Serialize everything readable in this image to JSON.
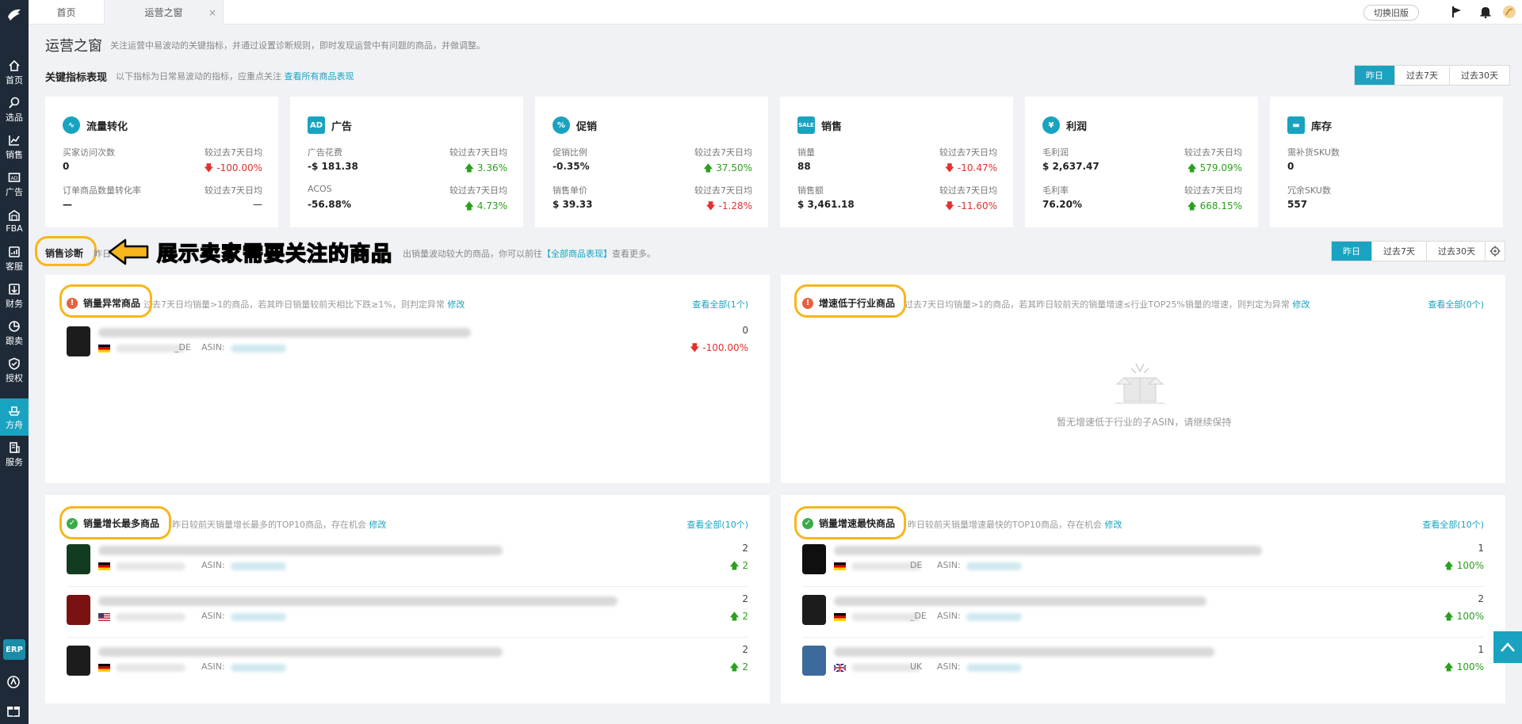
{
  "sidebar": {
    "items": [
      {
        "label": "首页",
        "icon": "home-icon"
      },
      {
        "label": "选品",
        "icon": "search-icon"
      },
      {
        "label": "销售",
        "icon": "chart-line-icon"
      },
      {
        "label": "广告",
        "icon": "ad-icon"
      },
      {
        "label": "FBA",
        "icon": "warehouse-icon"
      },
      {
        "label": "客服",
        "icon": "inbox-icon"
      },
      {
        "label": "财务",
        "icon": "finance-icon"
      },
      {
        "label": "跟卖",
        "icon": "pie-icon"
      },
      {
        "label": "授权",
        "icon": "shield-icon"
      },
      {
        "label": "方舟",
        "icon": "ark-icon"
      },
      {
        "label": "服务",
        "icon": "building-icon"
      }
    ],
    "erp_label": "ERP"
  },
  "tabs": {
    "home": "首页",
    "ops": "运营之窗",
    "close": "×"
  },
  "topbar": {
    "old_version": "切换旧版"
  },
  "header": {
    "title": "运营之窗",
    "desc": "关注运营中易波动的关键指标，并通过设置诊断规则，即时发现运营中有问题的商品，并做调整。"
  },
  "kpi_section": {
    "title": "关键指标表现",
    "desc": "以下指标为日常易波动的指标，应重点关注",
    "link": "查看所有商品表现",
    "ranges": [
      "昨日",
      "过去7天",
      "过去30天"
    ]
  },
  "kpis": [
    {
      "name": "流量转化",
      "icon": "traffic-icon",
      "icon_text": "∿",
      "rows": [
        {
          "label": "买家访问次数",
          "value": "0",
          "cmp": "较过去7天日均",
          "chg": "-100.00%",
          "dir": "down"
        },
        {
          "label": "订单商品数量转化率",
          "value": "—",
          "cmp": "较过去7天日均",
          "chg": "—",
          "dir": "none"
        }
      ]
    },
    {
      "name": "广告",
      "icon": "ad-badge-icon",
      "icon_text": "AD",
      "rows": [
        {
          "label": "广告花费",
          "value": "-$ 181.38",
          "cmp": "较过去7天日均",
          "chg": "3.36%",
          "dir": "up"
        },
        {
          "label": "ACOS",
          "value": "-56.88%",
          "cmp": "较过去7天日均",
          "chg": "4.73%",
          "dir": "up"
        }
      ]
    },
    {
      "name": "促销",
      "icon": "percent-icon",
      "icon_text": "%",
      "rows": [
        {
          "label": "促销比例",
          "value": "-0.35%",
          "cmp": "较过去7天日均",
          "chg": "37.50%",
          "dir": "up"
        },
        {
          "label": "销售单价",
          "value": "$ 39.33",
          "cmp": "较过去7天日均",
          "chg": "-1.28%",
          "dir": "down"
        }
      ]
    },
    {
      "name": "销售",
      "icon": "sale-tag-icon",
      "icon_text": "SALE",
      "rows": [
        {
          "label": "销量",
          "value": "88",
          "cmp": "较过去7天日均",
          "chg": "-10.47%",
          "dir": "down"
        },
        {
          "label": "销售额",
          "value": "$ 3,461.18",
          "cmp": "较过去7天日均",
          "chg": "-11.60%",
          "dir": "down"
        }
      ]
    },
    {
      "name": "利润",
      "icon": "yen-icon",
      "icon_text": "¥",
      "rows": [
        {
          "label": "毛利润",
          "value": "$ 2,637.47",
          "cmp": "较过去7天日均",
          "chg": "579.09%",
          "dir": "up"
        },
        {
          "label": "毛利率",
          "value": "76.20%",
          "cmp": "较过去7天日均",
          "chg": "668.15%",
          "dir": "up"
        }
      ]
    },
    {
      "name": "库存",
      "icon": "box-icon",
      "icon_text": "▬",
      "rows": [
        {
          "label": "需补货SKU数",
          "value": "0",
          "cmp": "",
          "chg": "",
          "dir": "none"
        },
        {
          "label": "冗余SKU数",
          "value": "557",
          "cmp": "",
          "chg": "",
          "dir": "none"
        }
      ]
    }
  ],
  "diag_section": {
    "title": "销售诊断",
    "desc_prefix": "昨日",
    "desc_mid": "出销量波动较大的商品，你可以前往",
    "link": "【全部商品表现】",
    "desc_suffix": "查看更多。",
    "ranges": [
      "昨日",
      "过去7天",
      "过去30天"
    ]
  },
  "annotation": {
    "text": "展示卖家需要关注的商品"
  },
  "panels": {
    "abnormal": {
      "title": "销量异常商品",
      "desc": "过去7天日均销量>1的商品，若其昨日销量较前天相比下跌≥1%，则判定异常",
      "edit": "修改",
      "all": "查看全部(1个)",
      "rows": [
        {
          "suffix": "_DE",
          "asin": "ASIN:",
          "value": "0",
          "chg": "-100.00%",
          "dir": "down",
          "flag": "de"
        }
      ]
    },
    "slow": {
      "title": "增速低于行业商品",
      "desc": "过去7天日均销量>1的商品，若其昨日较前天的销量增速≤行业TOP25%销量的增速，则判定为异常",
      "edit": "修改",
      "all": "查看全部(0个)",
      "empty": "暂无增速低于行业的子ASIN，请继续保持"
    },
    "growth": {
      "title": "销量增长最多商品",
      "desc": "昨日较前天销量增长最多的TOP10商品，存在机会",
      "edit": "修改",
      "all": "查看全部(10个)",
      "rows": [
        {
          "suffix": "",
          "asin": "ASIN:",
          "value": "2",
          "chg": "2",
          "dir": "up",
          "flag": "de"
        },
        {
          "suffix": "",
          "asin": "ASIN:",
          "value": "2",
          "chg": "2",
          "dir": "up",
          "flag": "us"
        },
        {
          "suffix": "",
          "asin": "ASIN:",
          "value": "2",
          "chg": "2",
          "dir": "up",
          "flag": "de"
        }
      ]
    },
    "fastest": {
      "title": "销量增速最快商品",
      "desc": "昨日较前天销量增速最快的TOP10商品，存在机会",
      "edit": "修改",
      "all": "查看全部(10个)",
      "rows": [
        {
          "suffix": "DE",
          "asin": "ASIN:",
          "value": "1",
          "chg": "100%",
          "dir": "up",
          "flag": "de"
        },
        {
          "suffix": "_DE",
          "asin": "ASIN:",
          "value": "2",
          "chg": "100%",
          "dir": "up",
          "flag": "de"
        },
        {
          "suffix": "UK",
          "asin": "ASIN:",
          "value": "1",
          "chg": "100%",
          "dir": "up",
          "flag": "uk"
        }
      ]
    }
  }
}
